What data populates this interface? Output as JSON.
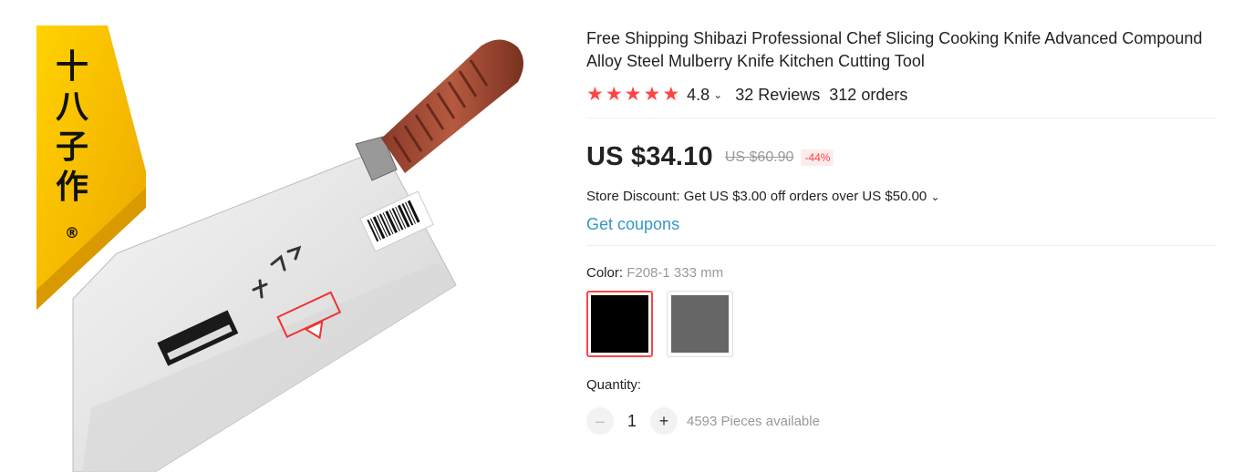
{
  "product": {
    "title": "Free Shipping Shibazi Professional Chef Slicing Cooking Knife Advanced Compound Alloy Steel Mulberry Knife Kitchen Cutting Tool",
    "rating": "4.8",
    "stars": 5,
    "reviews": "32 Reviews",
    "orders": "312 orders",
    "price": "US $34.10",
    "old_price": "US $60.90",
    "discount": "-44%",
    "store_discount": "Store Discount: Get US $3.00 off orders over US $50.00",
    "coupons": "Get coupons",
    "color_label": "Color: ",
    "color_value": "F208-1 333 mm",
    "swatches": [
      {
        "color": "#000000",
        "selected": true
      },
      {
        "color": "#666666",
        "selected": false
      }
    ],
    "quantity_label": "Quantity:",
    "quantity": "1",
    "available": "4593 Pieces available"
  },
  "banner": {
    "chars": [
      "十",
      "八",
      "子",
      "作"
    ],
    "reg_mark": "®"
  },
  "colors": {
    "accent": "#ff4444",
    "link": "#3597c6",
    "banner": "#f5c400"
  }
}
